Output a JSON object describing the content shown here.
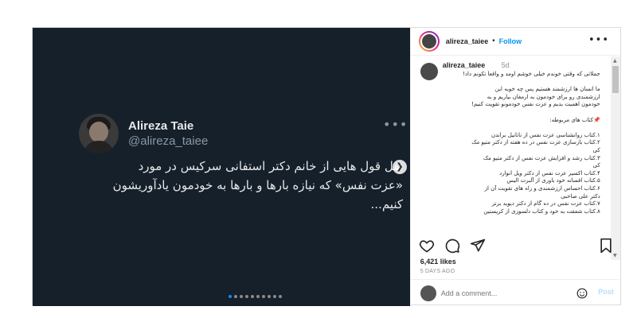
{
  "tweet": {
    "name": "Alireza Taie",
    "handle": "@alireza_taiee",
    "more": "•••",
    "lines": [
      "نقل قول هایی از خانم دکتر استفانی سرکیس در مورد",
      "«عزت نفس» که نیازه بارها و بارها به خودمون یادآوریشون",
      "کنیم..."
    ]
  },
  "carousel": {
    "slides": 10,
    "active": 0
  },
  "header": {
    "username": "alireza_taiee",
    "dot": "•",
    "follow": "Follow",
    "more": "•••"
  },
  "caption": {
    "username": "alireza_taiee",
    "time": "5d",
    "lines": [
      "جملاتی که وقتی خوندم خیلی خوشم اومد و واقعا تکونم داد!",
      "",
      "ما انسان ها ارزشمند هستیم پس چه خوبه این",
      "ارزشمندی رو برای خودمون به ارمغان بیاریم و به",
      "خودمون اهمیت بدیم و عزت نفس خودمونو تقویت کنیم!",
      "",
      "📌کتاب های مربوطه:",
      "",
      "۱.کتاب روانشناسی عزت نفس از ناتانیل براندن",
      "۲.کتاب بازسازی عزت نفس در ده هفته از دکتر متیو مک",
      "کی",
      "۳.کتاب رشد و افزایش عزت نفس از دکتر متیو مک",
      "کی",
      "۴.کتاب اکسیر عزت نفس از دکتر ویل انوارد",
      "۵.کتاب افسانه خود باوری از آلبرت الیس",
      "۶.کتاب احساس ارزشمندی و راه های تقویت آن از",
      "دکتر علی صاحبی",
      "۷.کتاب عزت نفس در ده گام از دکتر دیوید برنز",
      "۸.کتاب شفقت به خود و کتاب دلسوزی از کریستین"
    ]
  },
  "stats": {
    "likes": "6,421 likes",
    "time_ago": "5 DAYS AGO"
  },
  "comment_box": {
    "placeholder": "Add a comment...",
    "post": "Post"
  },
  "colors": {
    "media_bg": "#15202b",
    "link": "#0095f6",
    "post_disabled": "#b2dffc"
  }
}
